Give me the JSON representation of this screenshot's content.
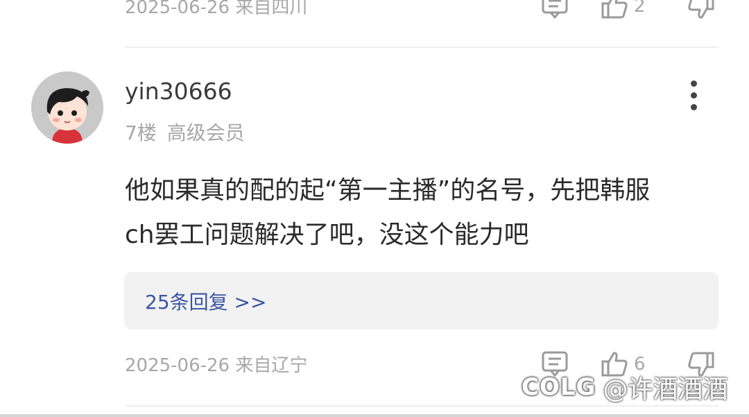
{
  "prev_comment": {
    "meta": "2025-06-26 来自四川",
    "like_count": "2"
  },
  "comment": {
    "username": "yin30666",
    "floor": "7楼",
    "member_level": "高级会员",
    "content_line1": "他如果真的配的起“第一主播”的名号，先把韩服",
    "content_line2": "ch罢工问题解决了吧，没这个能力吧",
    "replies_link": "25条回复 >>",
    "meta": "2025-06-26 来自辽宁",
    "like_count": "6"
  },
  "watermark": {
    "logo": "COLG",
    "handle": "@许酒酒酒"
  },
  "colors": {
    "link": "#3955a0",
    "meta_text": "#a7a7a7",
    "reply_bg": "#f2f2f3"
  }
}
